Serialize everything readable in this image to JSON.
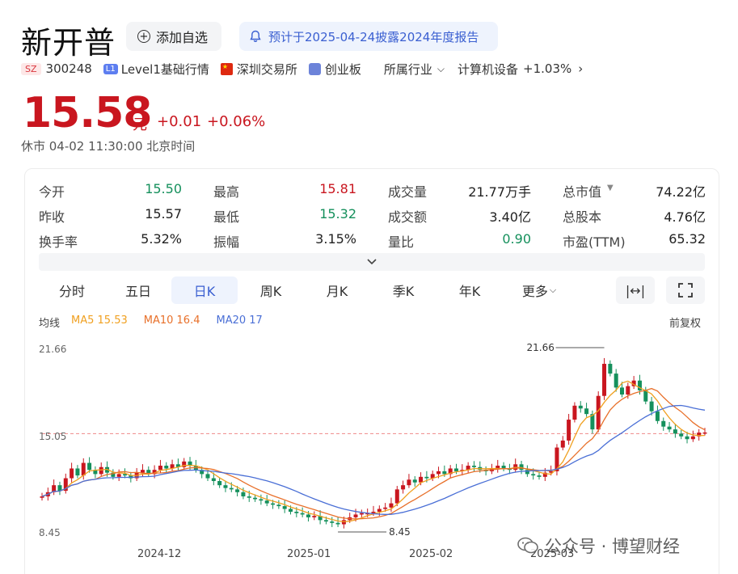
{
  "header": {
    "stock_name": "新开普",
    "add_watchlist": "添加自选",
    "notice": "预计于2025-04-24披露2024年度报告",
    "exchange_tag": "SZ",
    "code": "300248",
    "level_tag": "L1",
    "level_text": "Level1基础行情",
    "exchange": "深圳交易所",
    "board": "创业板",
    "industry_label": "所属行业",
    "industry_name": "计算机设备",
    "industry_change": "+1.03%"
  },
  "price": {
    "last": "15.58",
    "unit": "元",
    "change": "+0.01",
    "change_pct": "+0.06%",
    "status": "休市 04-02 11:30:00 北京时间"
  },
  "quotes": {
    "col1": [
      {
        "label": "今开",
        "value": "15.50",
        "trend": "down"
      },
      {
        "label": "昨收",
        "value": "15.57",
        "trend": "neutral"
      },
      {
        "label": "换手率",
        "value": "5.32%",
        "trend": "neutral"
      }
    ],
    "col2": [
      {
        "label": "最高",
        "value": "15.81",
        "trend": "up"
      },
      {
        "label": "最低",
        "value": "15.32",
        "trend": "down"
      },
      {
        "label": "振幅",
        "value": "3.15%",
        "trend": "neutral"
      }
    ],
    "col3": [
      {
        "label": "成交量",
        "value": "21.77万手",
        "trend": "neutral"
      },
      {
        "label": "成交额",
        "value": "3.40亿",
        "trend": "neutral"
      },
      {
        "label": "量比",
        "value": "0.90",
        "trend": "down"
      }
    ],
    "col4": [
      {
        "label": "总市值",
        "value": "74.22亿",
        "trend": "neutral"
      },
      {
        "label": "总股本",
        "value": "4.76亿",
        "trend": "neutral"
      },
      {
        "label": "市盈(TTM)",
        "value": "65.32",
        "trend": "neutral"
      }
    ]
  },
  "tabs": [
    "分时",
    "五日",
    "日K",
    "周K",
    "月K",
    "季K",
    "年K",
    "更多"
  ],
  "active_tab": "日K",
  "ma": {
    "label": "均线",
    "ma5": "MA5 15.53",
    "ma10": "MA10 16.4",
    "ma20": "MA20 17",
    "adjust": "前复权"
  },
  "colors": {
    "up": "#c9161f",
    "down": "#15905c",
    "ma5": "#f0a020",
    "ma10": "#e8702a",
    "ma20": "#4a6fd6",
    "accent": "#3a5fd1"
  },
  "chart_data": {
    "type": "candlestick",
    "y_high_label": "21.66",
    "y_low_label": "8.45",
    "y_ref_label": "15.05",
    "max_marker": "21.66",
    "min_marker": "8.45",
    "x_labels": [
      "2024-12",
      "2025-01",
      "2025-02",
      "2025-03"
    ],
    "ylim": [
      8.45,
      21.66
    ],
    "closes": [
      11.0,
      11.3,
      11.8,
      11.4,
      12.3,
      13.0,
      12.5,
      13.4,
      12.9,
      12.6,
      13.1,
      12.7,
      12.4,
      12.6,
      12.5,
      12.3,
      12.7,
      12.9,
      12.6,
      12.9,
      13.2,
      13.0,
      13.3,
      13.1,
      13.5,
      13.2,
      12.9,
      12.6,
      12.3,
      12.1,
      11.8,
      11.6,
      11.5,
      11.3,
      11.0,
      10.9,
      10.8,
      10.7,
      10.5,
      10.4,
      10.3,
      10.1,
      9.9,
      9.8,
      9.7,
      9.5,
      9.6,
      9.3,
      9.2,
      9.1,
      9.0,
      9.3,
      9.5,
      9.7,
      9.8,
      9.8,
      9.9,
      10.1,
      10.2,
      10.5,
      11.5,
      11.8,
      12.2,
      12.0,
      12.4,
      12.3,
      12.6,
      12.8,
      12.6,
      13.0,
      12.8,
      12.9,
      13.2,
      13.1,
      12.9,
      12.8,
      13.0,
      13.2,
      13.0,
      12.9,
      13.3,
      12.9,
      12.6,
      12.5,
      12.4,
      12.7,
      12.8,
      14.5,
      15.0,
      16.5,
      17.5,
      17.3,
      16.9,
      15.8,
      18.2,
      20.5,
      19.8,
      18.8,
      18.3,
      18.9,
      19.3,
      18.6,
      17.8,
      17.1,
      16.4,
      16.0,
      15.8,
      15.5,
      15.3,
      15.1,
      15.3,
      15.57,
      15.58
    ],
    "legend": [
      "MA5",
      "MA10",
      "MA20"
    ]
  },
  "watermark": "公众号 · 博望财经"
}
